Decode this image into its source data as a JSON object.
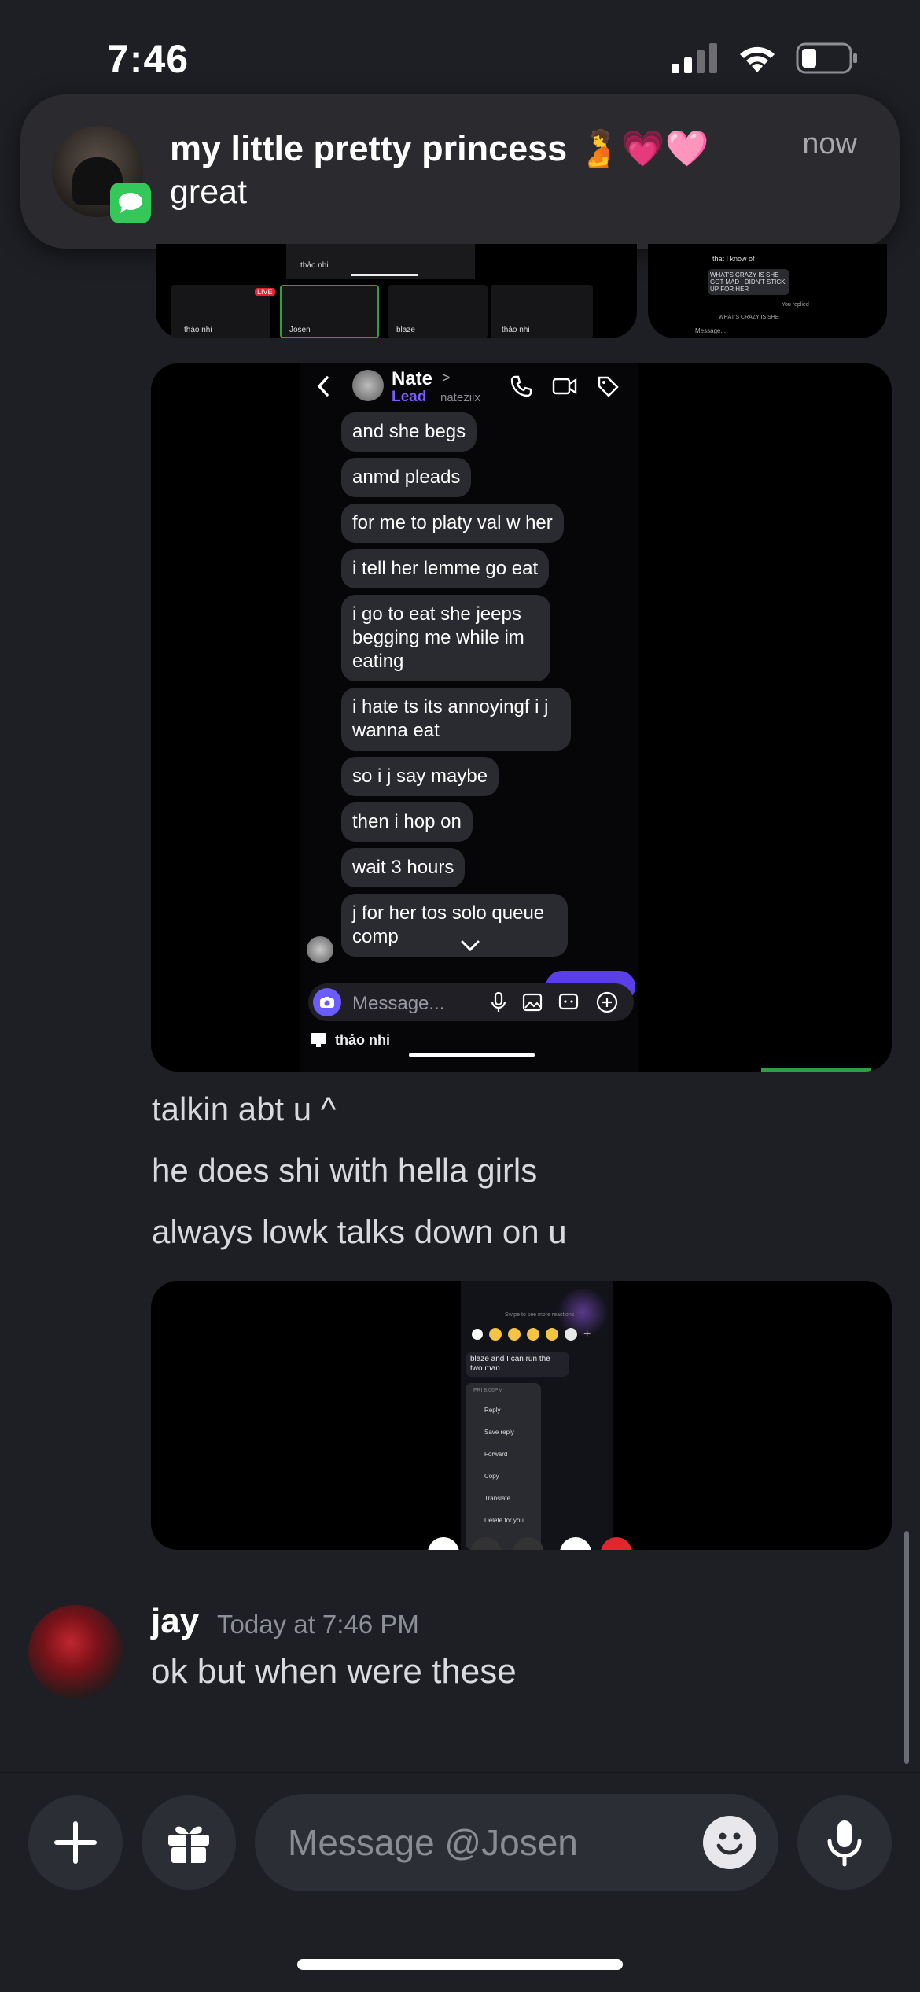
{
  "status_bar": {
    "time": "7:46"
  },
  "notification": {
    "title": "my little pretty princess 🫄💗🩷",
    "body": "great",
    "time": "now",
    "app_icon": "messages-icon"
  },
  "top_screenshot": {
    "left_labels": [
      "thảo nhi",
      "LIVE",
      "thảo nhi",
      "Josen",
      "blaze",
      "thảo nhi"
    ],
    "right_lines": [
      "that I know of",
      "WHAT'S CRAZY IS SHE GOT MAD I DIDN'T STICK UP FOR HER",
      "You replied",
      "WHAT'S CRAZY IS SHE",
      "Message..."
    ]
  },
  "screenshot_main": {
    "header_name": "Nate",
    "header_chevron": ">",
    "header_role": "Lead",
    "header_handle": "nateziix",
    "bubbles": [
      "and she begs",
      "anmd pleads",
      "for me to platy val w her",
      "i tell her lemme go eat",
      "i go to eat she jeeps begging me while im eating",
      "i hate ts its annoyingf i j wanna eat",
      "so i j say maybe",
      "then i hop on",
      "wait 3 hours",
      "j for her tos solo queue comp"
    ],
    "composer_placeholder": "Message...",
    "footer_label": "thảo nhi"
  },
  "messages_mid": [
    "talkin abt u ^",
    "he does shi with hella girls",
    "always lowk talks down on u"
  ],
  "screenshot_lower": {
    "hint": "Swipe to see more reactions",
    "message": "blaze and I can run the two man",
    "timestamp": "FRI 8:06PM",
    "menu_items": [
      "Reply",
      "Save reply",
      "Forward",
      "Copy",
      "Translate",
      "Delete for you"
    ]
  },
  "jay_message": {
    "author": "jay",
    "timestamp": "Today at 7:46 PM",
    "text": "ok but when were these"
  },
  "composer": {
    "placeholder": "Message @Josen"
  },
  "colors": {
    "background": "#1e1f24",
    "accent_purple": "#7b5cff",
    "imessage_green": "#34c759"
  }
}
